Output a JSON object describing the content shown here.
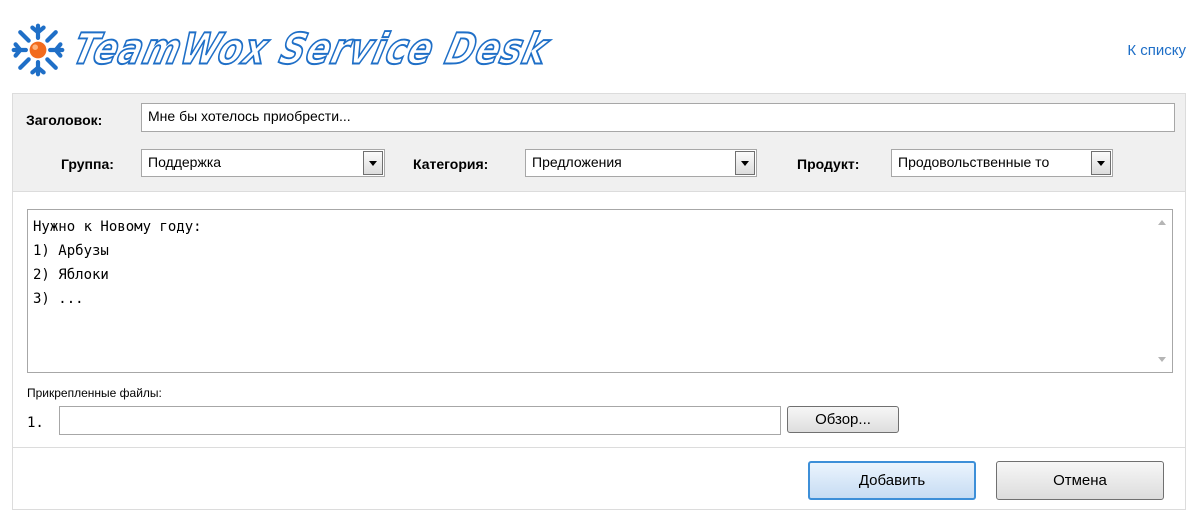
{
  "header": {
    "logo_text": "TeamWox Service Desk",
    "back_link": "К списку",
    "brand_color": "#1f6fc7"
  },
  "form": {
    "title_label": "Заголовок:",
    "title_value": "Мне бы хотелось приобрести...",
    "group_label": "Группа:",
    "group_value": "Поддержка",
    "category_label": "Категория:",
    "category_value": "Предложения",
    "product_label": "Продукт:",
    "product_value": "Продовольственные то",
    "body_text": "Нужно к Новому году:\n1) Арбузы\n2) Яблоки\n3) ...",
    "attachments_label": "Прикрепленные файлы:",
    "attachment_index": "1.",
    "browse_label": "Обзор..."
  },
  "actions": {
    "add_label": "Добавить",
    "cancel_label": "Отмена"
  }
}
